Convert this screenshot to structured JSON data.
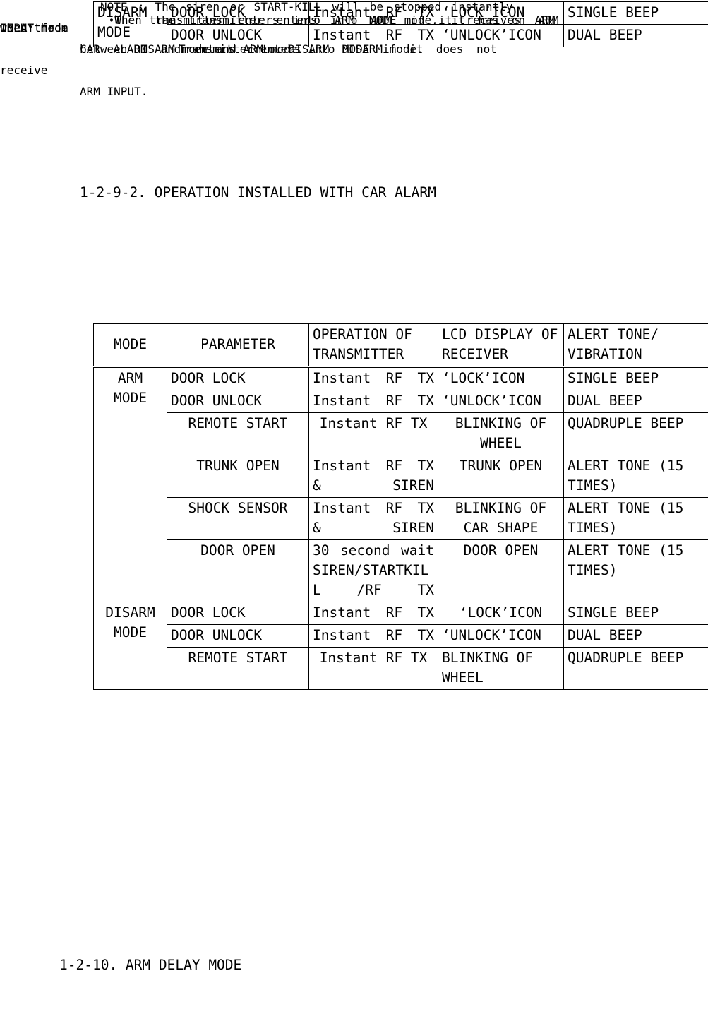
{
  "document": {
    "top_table": {
      "rows": [
        {
          "mode": "DISARM MODE",
          "parameter": "DOOR LOCK",
          "operation": "Instant  RF TX",
          "lcd": "‘LOCK’ICON",
          "alert": "SINGLE BEEP"
        },
        {
          "mode": "",
          "parameter": "DOOR UNLOCK",
          "operation": "Instant  RF TX",
          "lcd": "‘UNLOCK’ICON",
          "alert": "DUAL BEEP"
        }
      ]
    },
    "section_1": {
      "heading": "1-2-9-2. OPERATION INSTALLED WITH CAR ALARM",
      "bullet": "•",
      "line1": "The transmitter enters into ARM MODE if it receives ARM",
      "line2": "INPUT from",
      "line3": "CAR ALARM and enters into DISARM MODE if it does not",
      "line4": "receive",
      "line5": "ARM INPUT."
    },
    "main_table": {
      "headers": {
        "mode": "MODE",
        "parameter": "PARAMETER",
        "operation": "OPERATION OF TRANSMITTER",
        "lcd": "LCD DISPLAY OF RECEIVER",
        "alert": "ALERT TONE/ VIBRATION"
      },
      "arm_mode": {
        "label": "ARM MODE",
        "rows": [
          {
            "parameter": "DOOR LOCK",
            "operation": "Instant  RF TX",
            "lcd": "‘LOCK’ICON",
            "alert": "SINGLE BEEP"
          },
          {
            "parameter": "DOOR UNLOCK",
            "operation": "Instant  RF TX",
            "lcd": "‘UNLOCK’ICON",
            "alert": "DUAL BEEP"
          },
          {
            "parameter": "REMOTE START",
            "operation": "Instant RF TX",
            "lcd": "BLINKING OF WHEEL",
            "alert": "QUADRUPLE BEEP"
          },
          {
            "parameter": "TRUNK OPEN",
            "operation": "Instant  RF TX & SIREN",
            "lcd": "TRUNK OPEN",
            "alert": "ALERT TONE (15 TIMES)"
          },
          {
            "parameter": "SHOCK SENSOR",
            "operation": "Instant  RF TX & SIREN",
            "lcd": "BLINKING OF CAR SHAPE",
            "alert": "ALERT TONE (15 TIMES)"
          },
          {
            "parameter": "DOOR OPEN",
            "operation": "30   second wait SIREN/STARTKILL /RF TX",
            "lcd": "DOOR OPEN",
            "alert": "ALERT TONE (15 TIMES)"
          }
        ]
      },
      "disarm_mode": {
        "label": "DISARM MODE",
        "rows": [
          {
            "parameter": "DOOR LOCK",
            "operation": "Instant  RF TX",
            "lcd": "‘LOCK’ICON",
            "alert": "SINGLE BEEP"
          },
          {
            "parameter": "DOOR UNLOCK",
            "operation": "Instant  RF TX",
            "lcd": "‘UNLOCK’ICON",
            "alert": "DUAL BEEP"
          },
          {
            "parameter": "REMOTE START",
            "operation": "Instant RF TX",
            "lcd": "BLINKING OF WHEEL",
            "alert": "QUADRUPLE BEEP"
          }
        ]
      }
    },
    "note": {
      "line1": "NOTE : The siren or START-KILL will be stopped instantly",
      "line2": "when the",
      "line3": "Transmitter enters into DISARM mode."
    },
    "section_2": {
      "heading": "1-2-10. ARM DELAY MODE",
      "bullet": "•",
      "line1": "When the transmitter enters into ARM mode, it has on ARM",
      "line2": "DELAY mode",
      "line3": "between DISARM mode and ARM mode."
    }
  }
}
